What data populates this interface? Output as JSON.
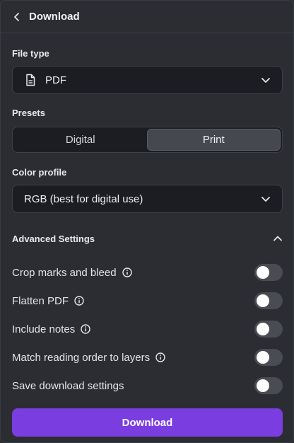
{
  "header": {
    "title": "Download"
  },
  "file_type": {
    "label": "File type",
    "value": "PDF"
  },
  "presets": {
    "label": "Presets",
    "options": [
      "Digital",
      "Print"
    ],
    "selected": "Print"
  },
  "color_profile": {
    "label": "Color profile",
    "value": "RGB (best for digital use)"
  },
  "advanced": {
    "title": "Advanced Settings",
    "expanded": true,
    "options": [
      {
        "label": "Crop marks and bleed",
        "info": true,
        "enabled": false
      },
      {
        "label": "Flatten PDF",
        "info": true,
        "enabled": false
      },
      {
        "label": "Include notes",
        "info": true,
        "enabled": false
      },
      {
        "label": "Match reading order to layers",
        "info": true,
        "enabled": false
      },
      {
        "label": "Save download settings",
        "info": false,
        "enabled": false
      }
    ]
  },
  "download_button": {
    "label": "Download"
  },
  "colors": {
    "accent": "#7a3de0",
    "panel": "#2b2d33",
    "field": "#1c1d22",
    "toggle_off": "#4a4c53"
  }
}
